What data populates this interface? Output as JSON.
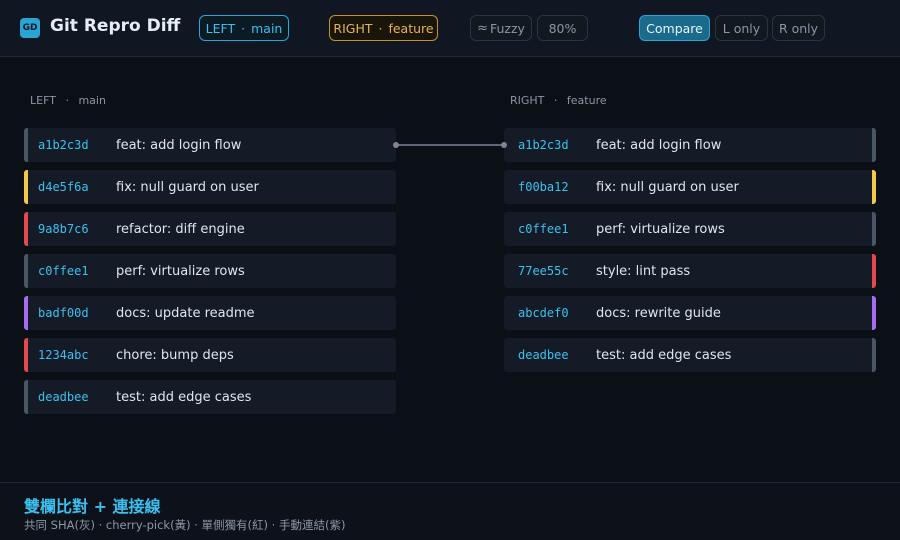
{
  "app": {
    "logo_text": "GD",
    "title": "Git Repro Diff"
  },
  "toolbar": {
    "left_label": "LEFT",
    "left_branch": "main",
    "right_label": "RIGHT",
    "right_branch": "feature",
    "fuzzy_label": "Fuzzy",
    "fuzzy_threshold": "80%",
    "compare_label": "Compare",
    "l_only_label": "L only",
    "r_only_label": "R only",
    "active_mode": "Compare"
  },
  "columns": {
    "left": {
      "label": "LEFT",
      "branch": "main"
    },
    "right": {
      "label": "RIGHT",
      "branch": "feature"
    }
  },
  "colors": {
    "common": "#4a5566",
    "cherry_pick": "#f2c94c",
    "single_side": "#e5484d",
    "manual_link": "#a66cf2",
    "sha": "#3cc0ef",
    "accent": "#2aa4d6"
  },
  "left_commits": [
    {
      "sha": "a1b2c3d",
      "message": "feat: add login flow",
      "status": "common"
    },
    {
      "sha": "d4e5f6a",
      "message": "fix: null guard on user",
      "status": "cherry_pick"
    },
    {
      "sha": "9a8b7c6",
      "message": "refactor: diff engine",
      "status": "single_side"
    },
    {
      "sha": "c0ffee1",
      "message": "perf: virtualize rows",
      "status": "common"
    },
    {
      "sha": "badf00d",
      "message": "docs: update readme",
      "status": "manual_link"
    },
    {
      "sha": "1234abc",
      "message": "chore: bump deps",
      "status": "single_side"
    },
    {
      "sha": "deadbee",
      "message": "test: add edge cases",
      "status": "common"
    }
  ],
  "right_commits": [
    {
      "sha": "a1b2c3d",
      "message": "feat: add login flow",
      "status": "common"
    },
    {
      "sha": "f00ba12",
      "message": "fix: null guard on user",
      "status": "cherry_pick"
    },
    {
      "sha": "c0ffee1",
      "message": "perf: virtualize rows",
      "status": "common"
    },
    {
      "sha": "77ee55c",
      "message": "style: lint pass",
      "status": "single_side"
    },
    {
      "sha": "abcdef0",
      "message": "docs: rewrite guide",
      "status": "manual_link"
    },
    {
      "sha": "deadbee",
      "message": "test: add edge cases",
      "status": "common"
    }
  ],
  "links": [
    {
      "left_sha": "a1b2c3d",
      "right_sha": "a1b2c3d"
    }
  ],
  "footer": {
    "title": "雙欄比對 + 連接線",
    "legend": "共同 SHA(灰) · cherry-pick(黃) · 單側獨有(紅) · 手動連結(紫)"
  }
}
